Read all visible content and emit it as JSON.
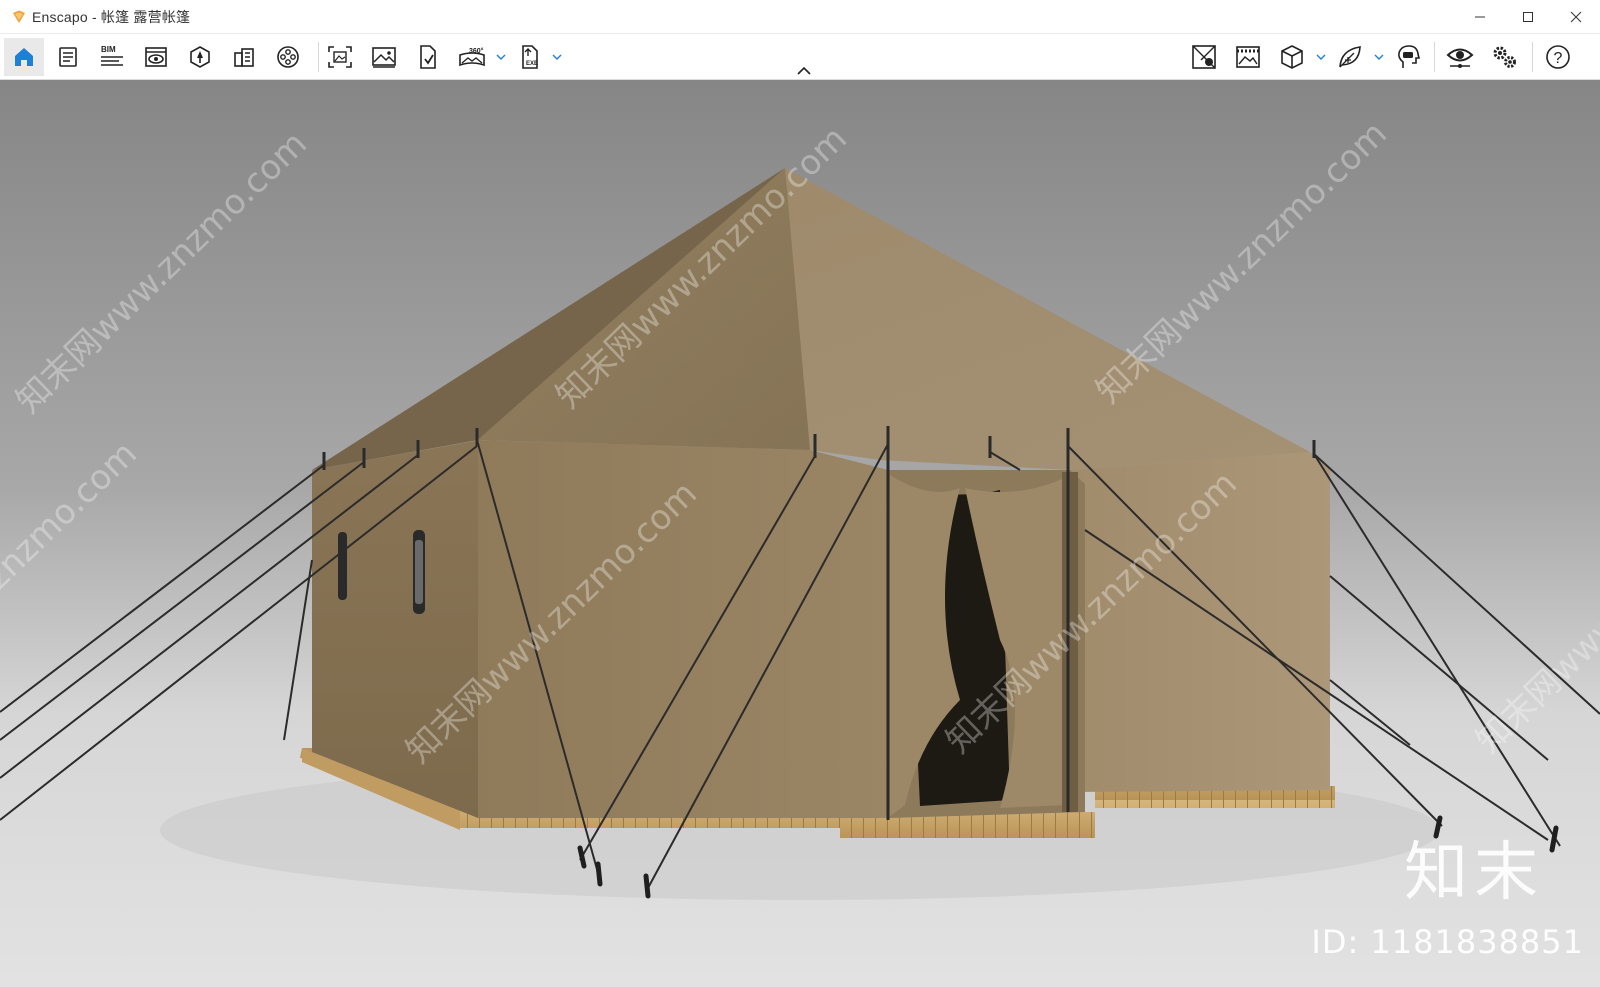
{
  "window": {
    "title": "Enscapo - 帐篷 露营帐篷",
    "controls": {
      "minimize_icon": "minimize-icon",
      "maximize_icon": "maximize-icon",
      "close_icon": "close-icon"
    }
  },
  "toolbar": {
    "left_tools": [
      {
        "id": "home",
        "icon": "home-icon",
        "active": true
      },
      {
        "id": "notes",
        "icon": "notes-icon"
      },
      {
        "id": "bim",
        "icon": "bim-icon",
        "label": "BIM"
      },
      {
        "id": "views",
        "icon": "view-eye-icon"
      },
      {
        "id": "assets",
        "icon": "asset-library-icon"
      },
      {
        "id": "materials",
        "icon": "material-editor-icon"
      },
      {
        "id": "video",
        "icon": "video-editor-icon"
      },
      {
        "id": "capture",
        "icon": "screenshot-icon"
      },
      {
        "id": "batch",
        "icon": "batch-render-icon"
      },
      {
        "id": "web",
        "icon": "web-standalone-icon"
      },
      {
        "id": "pano",
        "icon": "panorama-icon",
        "label": "360°"
      },
      {
        "id": "export",
        "icon": "export-exe-icon",
        "label": "EXE"
      }
    ],
    "right_tools": [
      {
        "id": "sun",
        "icon": "sun-position-icon"
      },
      {
        "id": "safe_frame",
        "icon": "safe-frame-icon"
      },
      {
        "id": "view_mode",
        "icon": "cube-view-icon"
      },
      {
        "id": "atmosphere",
        "icon": "leaf-atmosphere-icon"
      },
      {
        "id": "vr",
        "icon": "vr-headset-icon"
      },
      {
        "id": "visual_settings",
        "icon": "eye-settings-icon"
      },
      {
        "id": "general_settings",
        "icon": "gears-icon"
      },
      {
        "id": "help",
        "icon": "help-icon",
        "label": "?"
      }
    ]
  },
  "viewport": {
    "scene": "Rendered canvas tent on wooden platform with guy ropes",
    "watermark_text": "知末网www.znzmo.com",
    "brand_logo": "知末",
    "image_id": "ID: 1181838851",
    "colors": {
      "background_top": "#8a8a8a",
      "background_bottom": "#dadada",
      "canvas": "#9e8a68",
      "wood": "#c9a56b"
    }
  }
}
